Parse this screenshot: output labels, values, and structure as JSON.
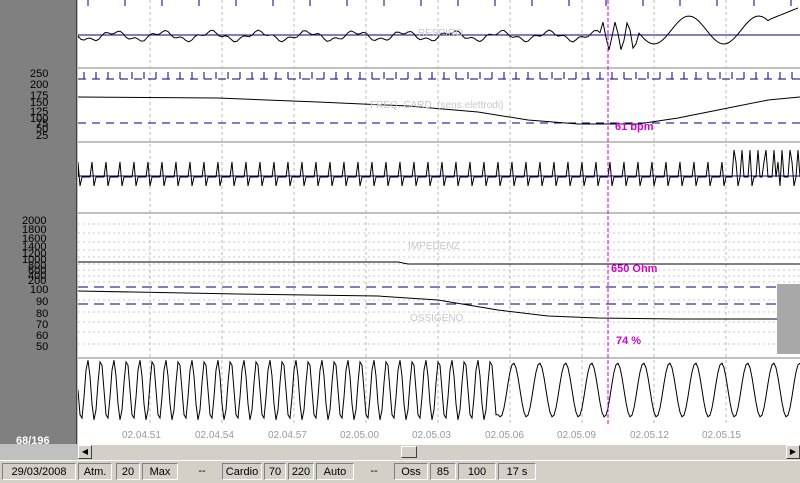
{
  "page_counter": "68/196",
  "scales": {
    "hr": [
      "250",
      "200",
      "175",
      "150",
      "125",
      "100",
      "75",
      "50",
      "25"
    ],
    "impedance": [
      "2000",
      "1800",
      "1600",
      "1400",
      "1200",
      "1000",
      "800",
      "600",
      "400",
      "200"
    ],
    "oxygen": [
      "100",
      "90",
      "80",
      "70",
      "60",
      "50"
    ]
  },
  "channel_titles": {
    "breath": "RESPIRO",
    "hr": "FREQ. CARD. (sens.elettrodi)",
    "impedance": "IMPEDENZ",
    "oxygen": "OSSIGENO"
  },
  "readouts": {
    "hr": "61 bpm",
    "impedance": "650 Ohm",
    "oxygen": "74 %"
  },
  "time_labels": [
    "02.04.51",
    "02.04.54",
    "02.04.57",
    "02.05.00",
    "02.05.03",
    "02.05.06",
    "02.05.09",
    "02.05.12",
    "02.05.15"
  ],
  "status": {
    "date": "29/03/2008",
    "atm_label": "Atm.",
    "atm_value": "20",
    "atm_mode": "Max",
    "atm_dash": "--",
    "cardio_label": "Cardio",
    "cardio_min": "70",
    "cardio_max": "220",
    "cardio_mode": "Auto",
    "cardio_dash": "--",
    "oss_label": "Oss",
    "oss_min": "85",
    "oss_max": "100",
    "duration": "17 s"
  },
  "colors": {
    "cursor": "#d000d0",
    "threshold": "#000080",
    "trace": "#000000",
    "panel": "#808080"
  }
}
